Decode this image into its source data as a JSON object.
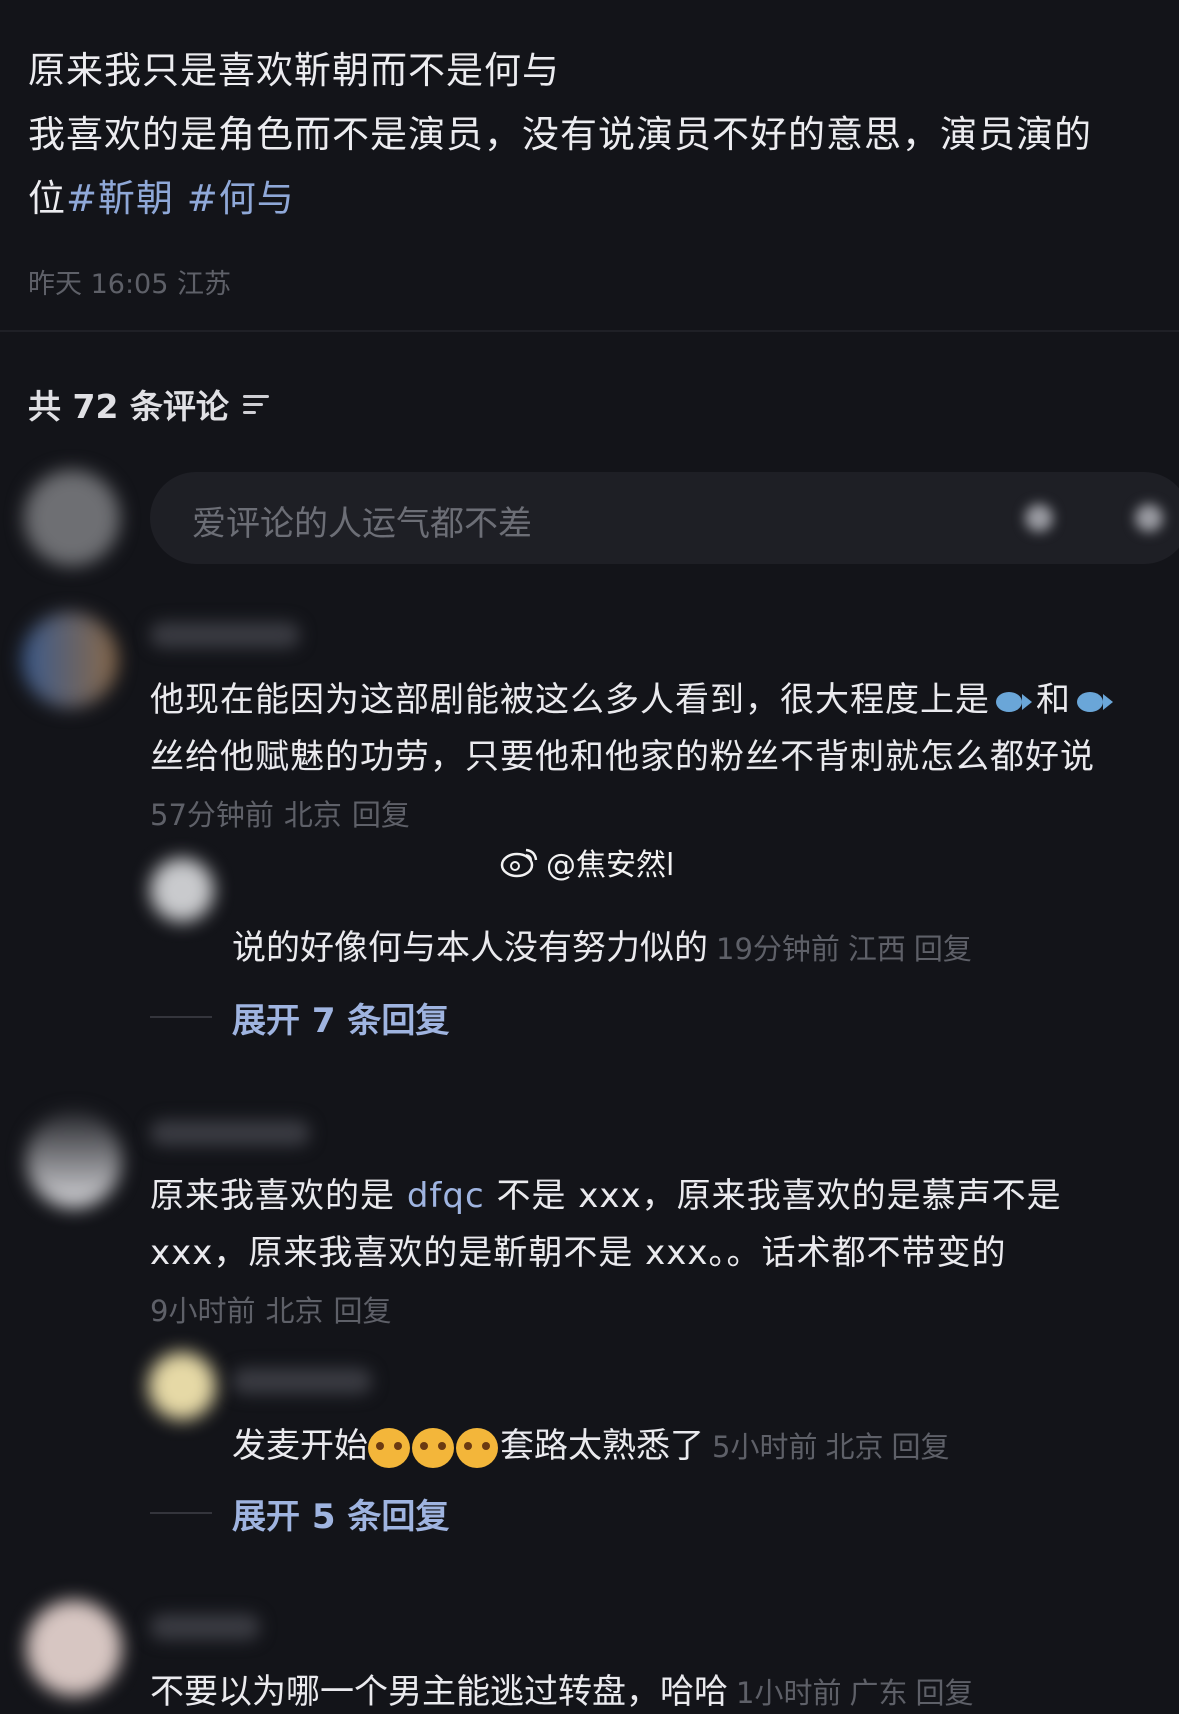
{
  "post": {
    "line1": "原来我只是喜欢靳朝而不是何与",
    "line2": "我喜欢的是角色而不是演员，没有说演员不好的意思，演员演的",
    "line3_prefix": "位",
    "tags": [
      "#靳朝",
      "#何与"
    ],
    "time": "昨天 16:05 江苏"
  },
  "comments_header": {
    "count_label": "共 72 条评论"
  },
  "comment_input": {
    "placeholder": "爱评论的人运气都不差"
  },
  "watermark": {
    "text": "@焦安然l"
  },
  "comments": [
    {
      "line1_a": "他现在能因为这部剧能被这么多人看到，很大程度上是",
      "line1_b": "和",
      "line2": "丝给他赋魅的功劳，只要他和他家的粉丝不背刺就怎么都好说",
      "time": "57分钟前",
      "location": "北京",
      "reply_label": "回复",
      "reply": {
        "text": "说的好像何与本人没有努力似的",
        "time": "19分钟前",
        "location": "江西",
        "reply_label": "回复"
      },
      "expand_label": "展开 7 条回复"
    },
    {
      "line1_a": "原来我喜欢的是 ",
      "link": "dfqc",
      "line1_b": " 不是 xxx，原来我喜欢的是慕声不是",
      "line2": "xxx，原来我喜欢的是靳朝不是 xxx。。话术都不带变的",
      "time": "9小时前",
      "location": "北京",
      "reply_label": "回复",
      "reply": {
        "text_a": "发麦开始",
        "text_b": "套路太熟悉了",
        "time": "5小时前",
        "location": "北京",
        "reply_label": "回复"
      },
      "expand_label": "展开 5 条回复"
    },
    {
      "text": "不要以为哪一个男主能逃过转盘，哈哈",
      "time": "1小时前",
      "location": "广东",
      "reply_label": "回复"
    }
  ]
}
